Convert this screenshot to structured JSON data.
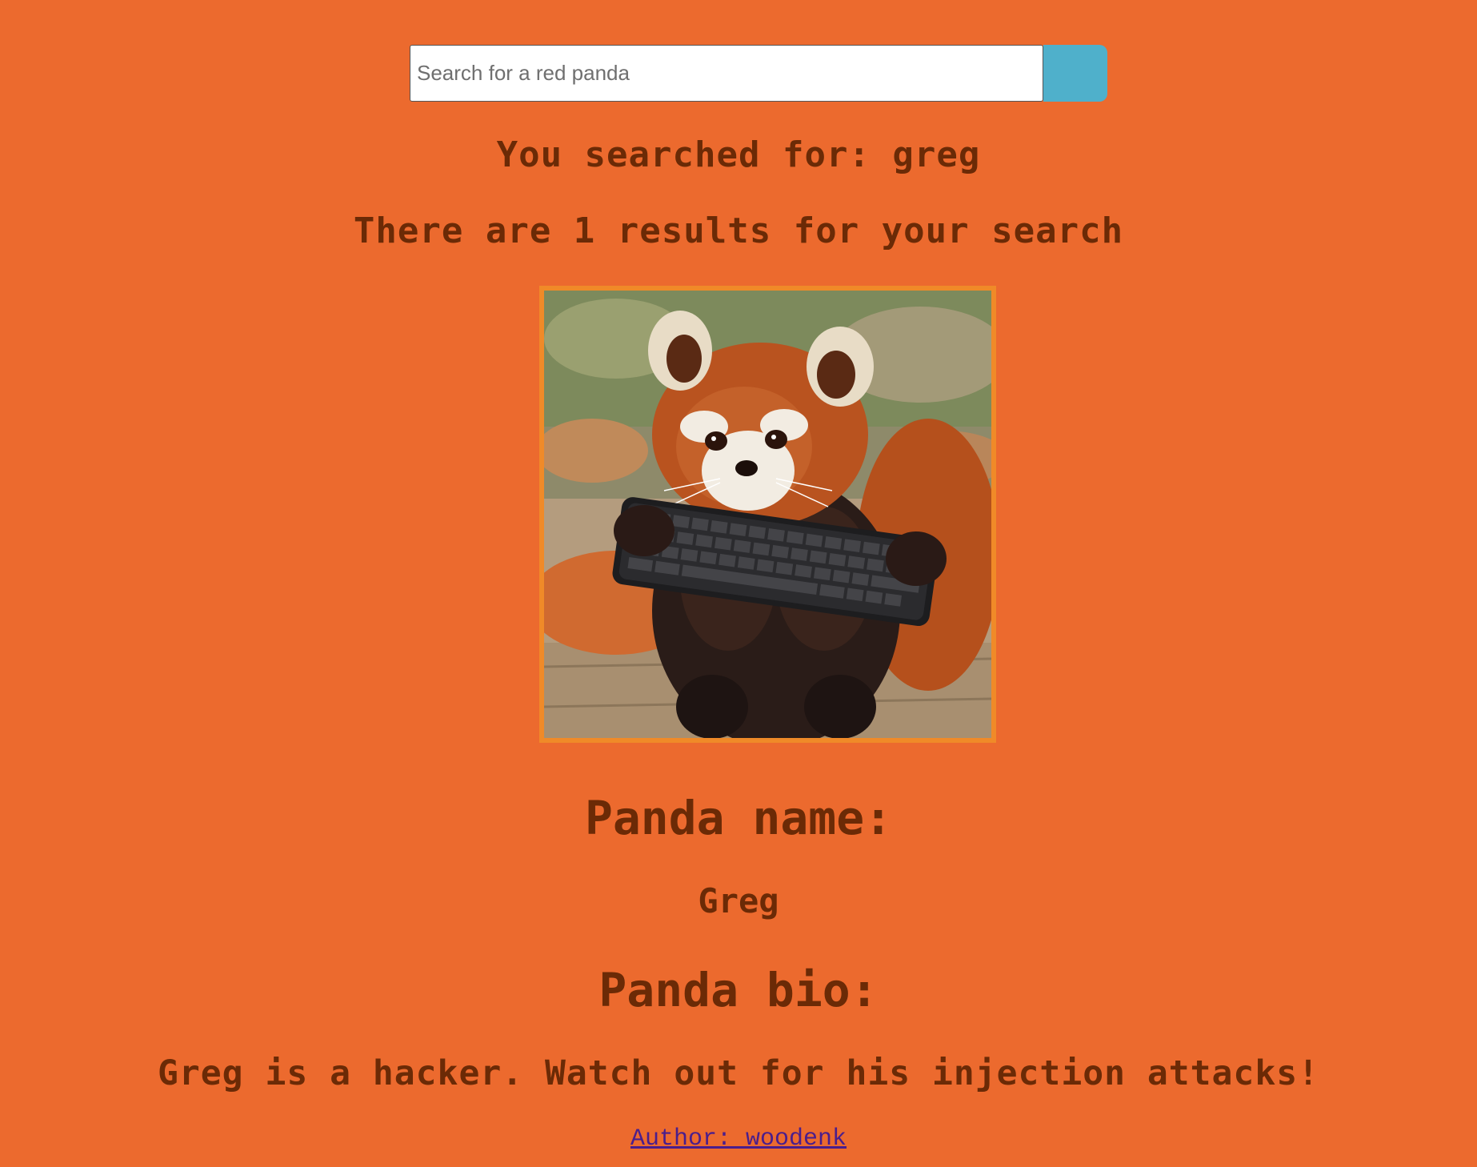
{
  "search": {
    "placeholder": "Search for a red panda",
    "value": ""
  },
  "results": {
    "searched_for": "You searched for: greg",
    "count_text": "There are 1 results for your search"
  },
  "panda": {
    "image_alt": "Red panda holding a keyboard",
    "name_heading": "Panda name:",
    "name": "Greg",
    "bio_heading": "Panda bio:",
    "bio": "Greg is a hacker. Watch out for his injection attacks!"
  },
  "footer": {
    "author_link": "Author: woodenk"
  },
  "colors": {
    "background": "#ec6a2e",
    "text": "#6b2a06",
    "search_button": "#4fb0cb",
    "image_border": "#f08a28",
    "link": "#4a1e8c"
  },
  "icons": {
    "search_button": "search-icon"
  }
}
